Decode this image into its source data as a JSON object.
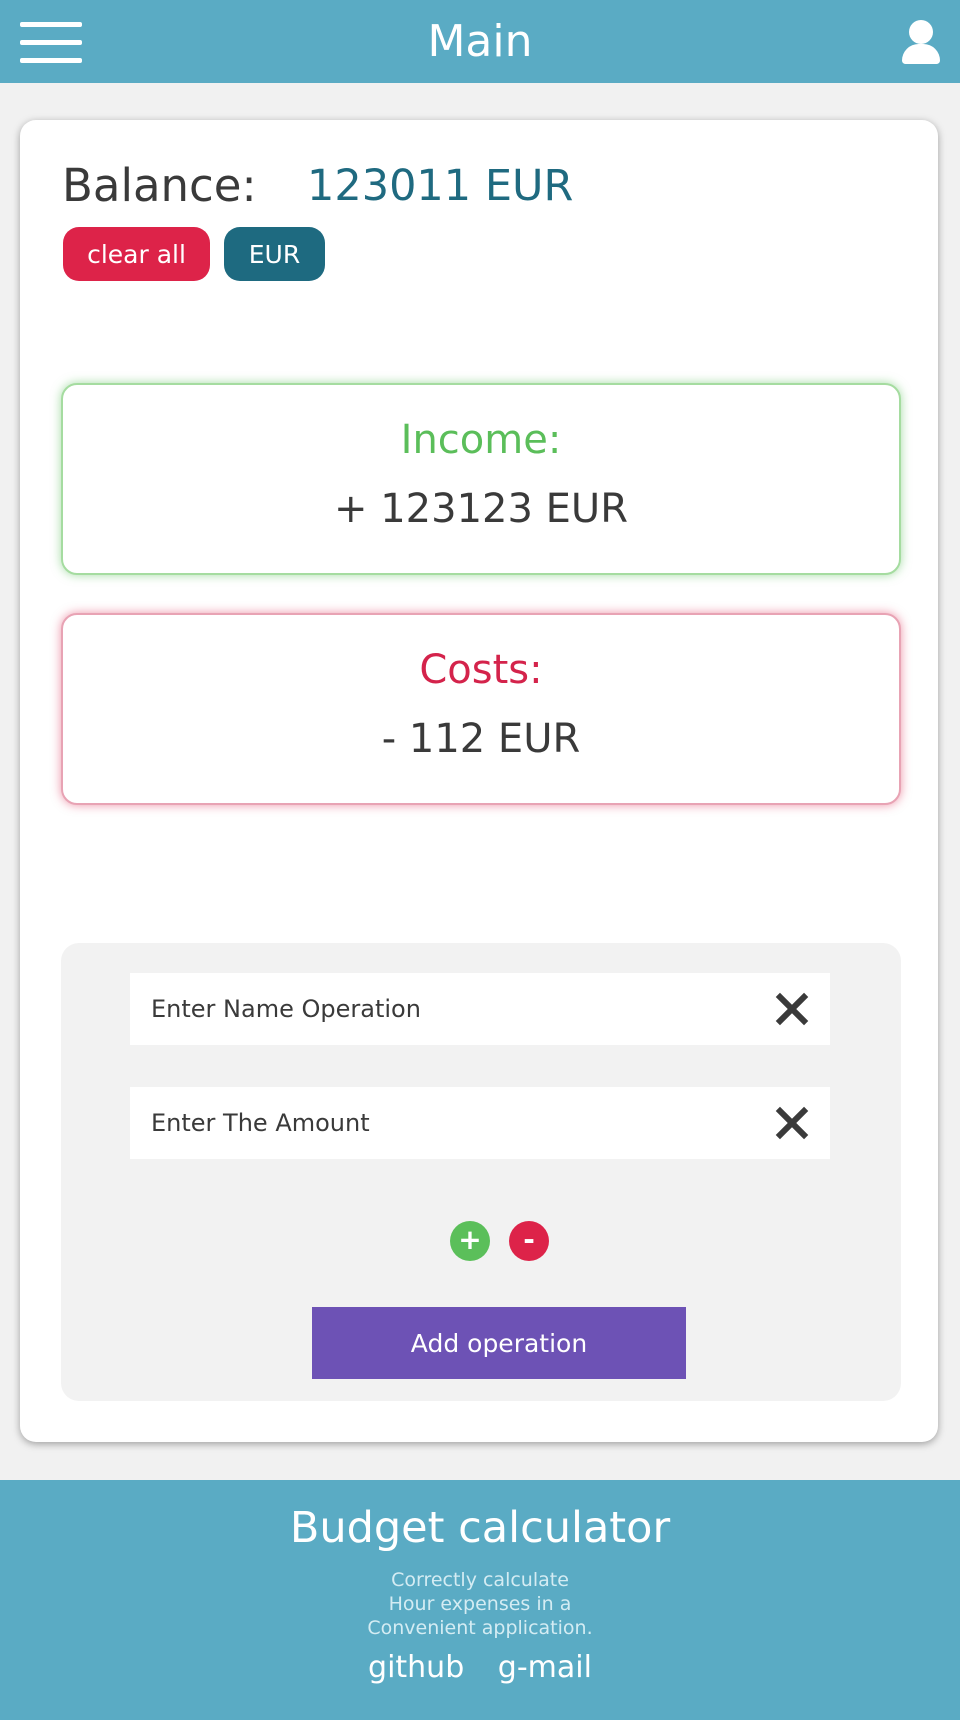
{
  "header": {
    "title": "Main",
    "menu_icon": "hamburger-menu-icon",
    "user_icon": "user-icon"
  },
  "balance": {
    "label": "Balance:",
    "value": "123011 EUR",
    "clear_all_label": "clear all",
    "currency_label": "EUR"
  },
  "income": {
    "title": "Income:",
    "value": "+ 123123 EUR"
  },
  "costs": {
    "title": "Costs:",
    "value": "- 112 EUR"
  },
  "form": {
    "name_placeholder": "Enter Name Operation",
    "amount_placeholder": "Enter The Amount",
    "clear_icon": "close-icon",
    "plus_label": "+",
    "minus_label": "-",
    "add_label": "Add operation"
  },
  "footer": {
    "title": "Budget calculator",
    "tagline": [
      "Correctly calculate",
      "Hour expenses in a",
      "Convenient application."
    ],
    "links": [
      "github",
      "g-mail"
    ]
  },
  "colors": {
    "header_bg": "#5aabc4",
    "balance_value": "#1f6a80",
    "clear_all": "#dd2349",
    "currency": "#1e6a80",
    "income": "#5bbe5a",
    "costs": "#d4234b",
    "add_button": "#6d52b5"
  }
}
